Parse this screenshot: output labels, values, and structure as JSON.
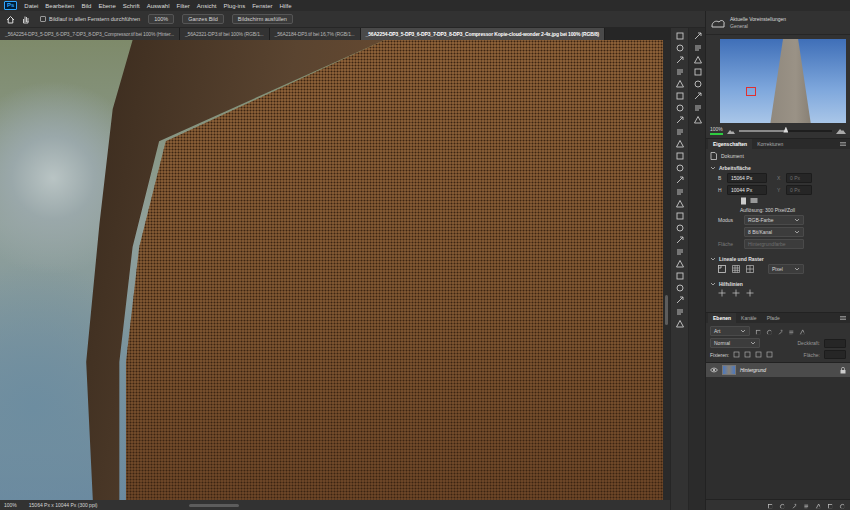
{
  "menu_bar": {
    "logo": "Ps",
    "items": [
      "Datei",
      "Bearbeiten",
      "Bild",
      "Ebene",
      "Schrift",
      "Auswahl",
      "Filter",
      "Ansicht",
      "Plug-ins",
      "Fenster",
      "Hilfe"
    ]
  },
  "options_bar": {
    "scroll_all": {
      "label": "Bildlauf in allen Fenstern durchführen",
      "checked": false
    },
    "buttons": [
      "100%",
      "Ganzes Bild",
      "Bildschirm ausfüllen"
    ]
  },
  "document_tabs": [
    {
      "label": "_56A2254-DP3_5-DP3_6-DP3_7-DP3_8-DP3_Compressor.tif bei 100% (Hinter...",
      "selected": false
    },
    {
      "label": "_56A2321-DP3.tif bei 100% (RGB/1...",
      "selected": false
    },
    {
      "label": "_56A2184-DP3.tif bei 16,7% (RGB/1...",
      "selected": false
    },
    {
      "label": "_56A2254-DP3_5-DP3_6-DP3_7-DP3_8-DP3_Compressor Kopie-cloud-wonder 2-4x.jpg bei 100% (RGB/8)",
      "selected": true
    }
  ],
  "status_bar": {
    "zoom": "100%",
    "info": "15064 Px x 10044 Px (300 ppi)"
  },
  "navigator": {
    "title": "Aktuelle Voreinstellungen",
    "subtitle": "General",
    "zoom": "100%",
    "zoom_level": 0.5
  },
  "properties": {
    "tabs": [
      {
        "label": "Eigenschaften",
        "selected": true
      },
      {
        "label": "Korrekturen",
        "selected": false
      }
    ],
    "document_label": "Dokument",
    "canvas_section": "Arbeitsfläche",
    "width": {
      "label": "B",
      "value": "15064 Px"
    },
    "height": {
      "label": "H",
      "value": "10044 Px"
    },
    "x": {
      "label": "X",
      "value": "0 Px",
      "disabled": true
    },
    "y": {
      "label": "Y",
      "value": "0 Px",
      "disabled": true
    },
    "resolution": "Auflösung: 300 Pixel/Zoll",
    "mode_label": "Modus",
    "mode": "RGB-Farbe",
    "depth": "8 Bit/Kanal",
    "fill": {
      "label": "Fläche",
      "value": "Hintergrundfarbe",
      "disabled": true
    },
    "rulers_section": "Lineale und Raster",
    "units": "Pixel",
    "guides_section": "Hilfslinien"
  },
  "layers": {
    "tabs": [
      {
        "label": "Ebenen",
        "selected": true
      },
      {
        "label": "Kanäle",
        "selected": false
      },
      {
        "label": "Pfade",
        "selected": false
      }
    ],
    "filter": "Art",
    "blend_mode": "Normal",
    "opacity_label": "Deckkraft:",
    "lock_label": "Fixieren:",
    "fill_label": "Fläche:",
    "rows": [
      {
        "name": "Hintergrund",
        "visible": true,
        "selected": true,
        "locked": true
      }
    ]
  }
}
